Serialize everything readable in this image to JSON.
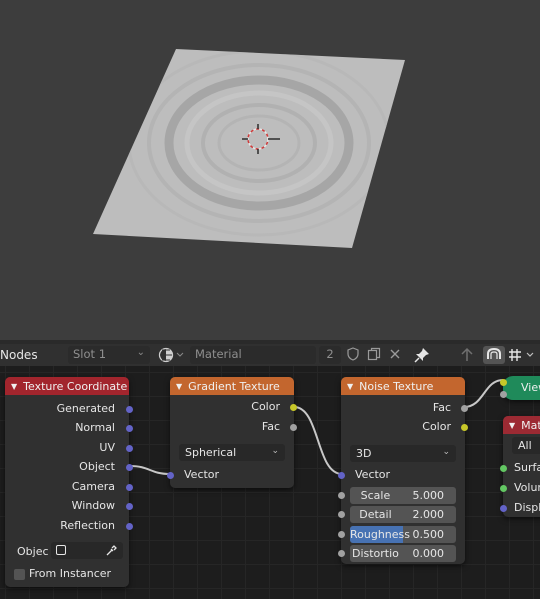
{
  "header": {
    "editor_title": "Nodes",
    "slot": "Slot 1",
    "material": "Material",
    "user_count": "2"
  },
  "nodes": {
    "texture_coordinate": {
      "title": "Texture Coordinate",
      "outputs": [
        "Generated",
        "Normal",
        "UV",
        "Object",
        "Camera",
        "Window",
        "Reflection"
      ],
      "object_label": "Objec",
      "from_instancer": "From Instancer"
    },
    "gradient_texture": {
      "title": "Gradient Texture",
      "outputs": [
        "Color",
        "Fac"
      ],
      "type": "Spherical",
      "input": "Vector"
    },
    "noise_texture": {
      "title": "Noise Texture",
      "outputs": [
        "Fac",
        "Color"
      ],
      "dimensions": "3D",
      "input": "Vector",
      "fields": [
        {
          "label": "Scale",
          "value": "5.000"
        },
        {
          "label": "Detail",
          "value": "2.000"
        },
        {
          "label": "Roughness",
          "value": "0.500",
          "fill": 0.5
        },
        {
          "label": "Distortio",
          "value": "0.000"
        }
      ]
    },
    "viewer": {
      "title": "View"
    },
    "material_output": {
      "title": "Mat",
      "target": "All",
      "inputs": [
        "Surfa",
        "Volur",
        "Displ"
      ]
    }
  },
  "colors": {
    "texcoord_header": "#a2252d",
    "texture_header": "#c3662e",
    "viewer_header": "#1f8a5a",
    "output_header": "#9c2a33"
  }
}
